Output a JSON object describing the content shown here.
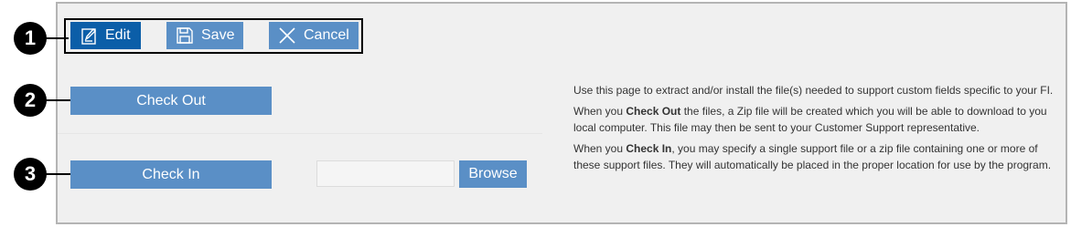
{
  "toolbar": {
    "edit_label": "Edit",
    "save_label": "Save",
    "cancel_label": "Cancel"
  },
  "actions": {
    "check_out_label": "Check Out",
    "check_in_label": "Check In",
    "browse_label": "Browse",
    "file_input_value": ""
  },
  "callouts": [
    "1",
    "2",
    "3"
  ],
  "help": {
    "p1": "Use this page to extract and/or install the file(s) needed to support custom fields specific to your FI.",
    "p2_pre": "When you ",
    "p2_bold": "Check Out",
    "p2_post": " the files, a Zip file will be created which you will be able to download to you local computer.  This file may then be sent to your Customer Support representative.",
    "p3_pre": "When you ",
    "p3_bold": "Check In",
    "p3_post": ", you may specify a single support file or a zip file containing one or more of these support files.  They will automatically be placed in the proper location for use by the program."
  },
  "colors": {
    "button": "#5a8fc6",
    "button_active": "#0b5ea8",
    "panel_bg": "#f0f0f0",
    "callout": "#000000"
  },
  "icons": {
    "edit": "pencil-icon",
    "save": "floppy-disk-icon",
    "cancel": "close-icon"
  }
}
